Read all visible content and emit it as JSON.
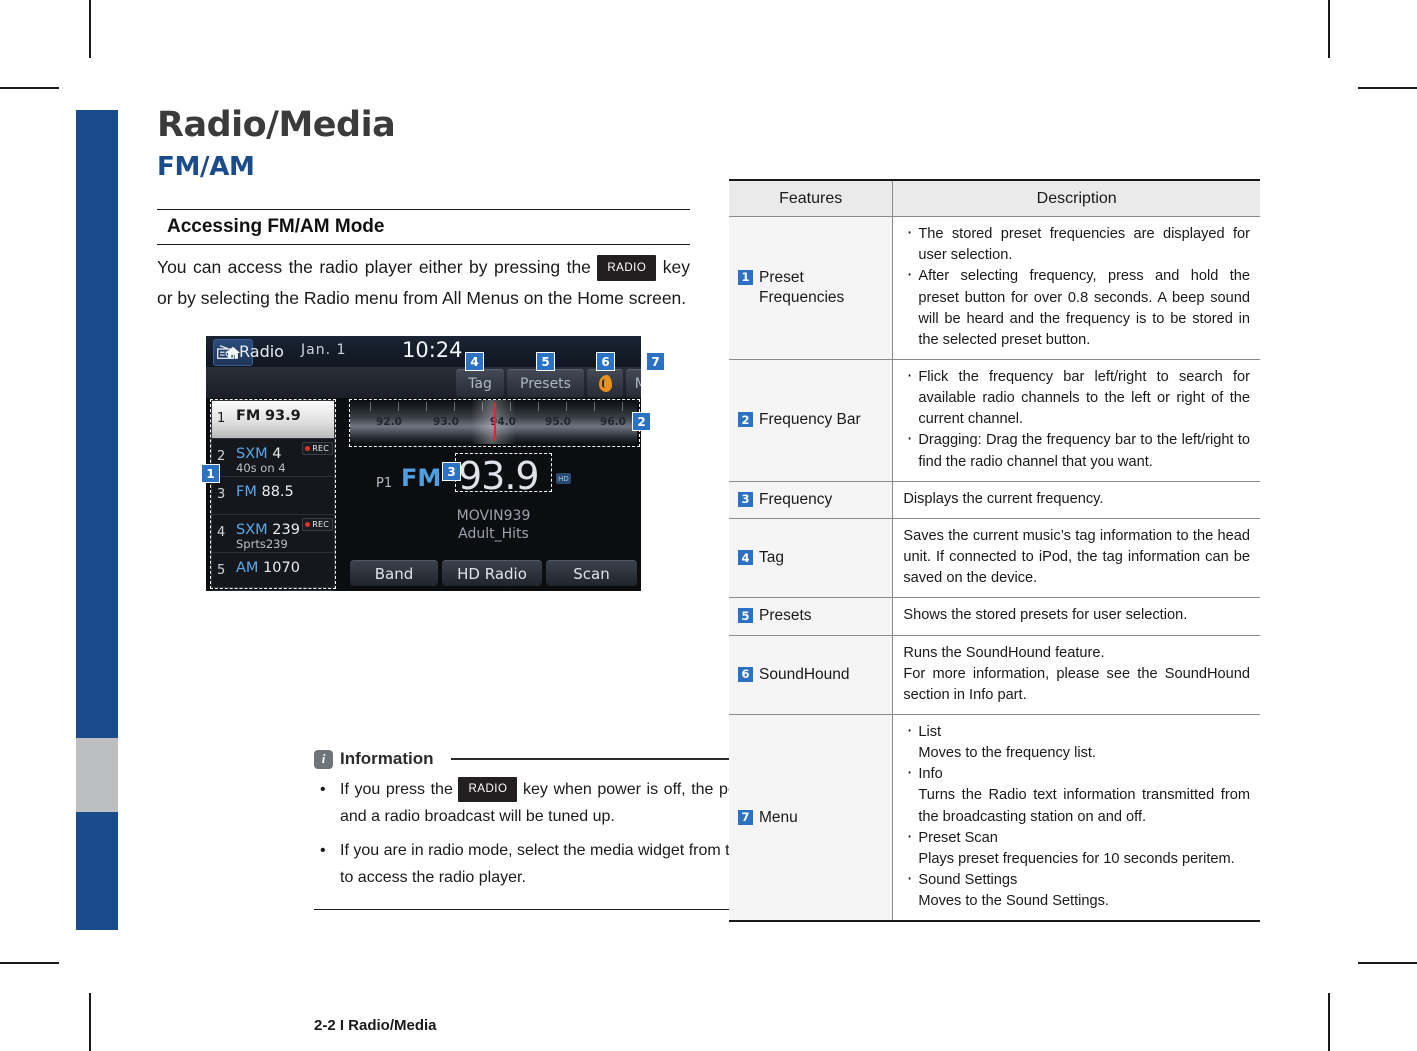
{
  "page": {
    "title": "Radio/Media",
    "section": "FM/AM",
    "subhead": "Accessing FM/AM Mode",
    "body_part1": "You can access the radio player either by pressing the",
    "body_keycap": "RADIO",
    "body_part2": "key or by selecting the Radio menu from All Menus on the Home screen.",
    "footer": "2-2 I Radio/Media"
  },
  "information": {
    "heading": "Information",
    "icon": "info-icon",
    "items": [
      {
        "before": "If you press the",
        "keycap": "RADIO",
        "after": "key when power is off, the power will turn on and a radio broadcast will be tuned up."
      },
      {
        "before": "",
        "keycap": "",
        "after": "If you are in radio mode, select the media widget from the Home screen to access the radio player."
      }
    ]
  },
  "radio_ui": {
    "status": {
      "home_icon": "home-icon",
      "date": "Jan.  1",
      "clock": "10:24"
    },
    "toolbar": {
      "mode_icon": "radio-icon",
      "mode_label": "Radio",
      "buttons": [
        {
          "label": "Tag",
          "name": "tag-button",
          "badge": "4"
        },
        {
          "label": "Presets",
          "name": "presets-button",
          "badge": "5"
        },
        {
          "label": "",
          "name": "soundhound-button",
          "badge": "6",
          "icon": "soundhound-icon"
        },
        {
          "label": "Menu",
          "name": "menu-button",
          "badge": "7"
        },
        {
          "label": "",
          "name": "back-button",
          "icon": "back-arrow-icon"
        }
      ]
    },
    "presets_badge": "1",
    "presets": [
      {
        "num": "1",
        "band": "FM",
        "freq": "93.9",
        "sub": "",
        "rec": false,
        "selected": true
      },
      {
        "num": "2",
        "band": "SXM",
        "freq": "4",
        "sub": "40s on 4",
        "rec": true,
        "selected": false
      },
      {
        "num": "3",
        "band": "FM",
        "freq": "88.5",
        "sub": "",
        "rec": false,
        "selected": false
      },
      {
        "num": "4",
        "band": "SXM",
        "freq": "239",
        "sub": "Sprts239",
        "rec": true,
        "selected": false
      },
      {
        "num": "5",
        "band": "AM",
        "freq": "1070",
        "sub": "",
        "rec": false,
        "selected": false
      }
    ],
    "rec_label": "REC",
    "frequency_bar": {
      "badge": "2",
      "ticks": [
        "92.0",
        "93.0",
        "94.0",
        "95.0",
        "96.0"
      ],
      "needle_value": "93.9"
    },
    "now_playing": {
      "badge": "3",
      "preset": "P1",
      "band": "FM",
      "frequency": "93.9",
      "hd_icon": "hd-radio-icon",
      "station": "MOVIN939",
      "genre": "Adult_Hits"
    },
    "bottom_buttons": [
      {
        "label": "Band",
        "name": "band-button"
      },
      {
        "label": "HD Radio",
        "name": "hd-radio-button"
      },
      {
        "label": "Scan",
        "name": "scan-button"
      }
    ]
  },
  "table": {
    "headers": [
      "Features",
      "Description"
    ],
    "rows": [
      {
        "badge": "1",
        "feature": "Preset\nFrequencies",
        "desc": [
          {
            "type": "bullet",
            "text": "The stored preset frequencies are displayed for user selection."
          },
          {
            "type": "bullet",
            "text": "After selecting frequency, press and hold the preset button for over 0.8 seconds. A beep sound will be heard and the frequency is to be stored in the selected preset button."
          }
        ]
      },
      {
        "badge": "2",
        "feature": "Frequency Bar",
        "desc": [
          {
            "type": "bullet",
            "text": "Flick the frequency bar left/right to search for available radio channels to the left or right of the current channel."
          },
          {
            "type": "bullet",
            "text": "Dragging: Drag the frequency bar to the left/right to find the radio channel that you want."
          }
        ]
      },
      {
        "badge": "3",
        "feature": "Frequency",
        "desc": [
          {
            "type": "plain",
            "text": "Displays the current frequency."
          }
        ]
      },
      {
        "badge": "4",
        "feature": "Tag",
        "desc": [
          {
            "type": "plain",
            "text": "Saves the current music’s tag information to the head unit. If connected to iPod, the tag information can be saved on the device."
          }
        ]
      },
      {
        "badge": "5",
        "feature": "Presets",
        "desc": [
          {
            "type": "plain",
            "text": "Shows the stored presets for user selection."
          }
        ]
      },
      {
        "badge": "6",
        "feature": "SoundHound",
        "desc": [
          {
            "type": "plain",
            "text": "Runs the SoundHound feature."
          },
          {
            "type": "plain",
            "text": "For more information, please see the SoundHound section in Info part."
          }
        ]
      },
      {
        "badge": "7",
        "feature": "Menu",
        "desc": [
          {
            "type": "bullet",
            "text": "List"
          },
          {
            "type": "sub",
            "text": "Moves to the frequency list."
          },
          {
            "type": "bullet",
            "text": "Info"
          },
          {
            "type": "sub",
            "text": "Turns the Radio text information transmitted from the broadcasting station on and off."
          },
          {
            "type": "bullet",
            "text": "Preset Scan"
          },
          {
            "type": "sub",
            "text": "Plays preset frequencies for 10 seconds peritem."
          },
          {
            "type": "bullet",
            "text": "Sound Settings"
          },
          {
            "type": "sub",
            "text": "Moves to the Sound Settings."
          }
        ]
      }
    ]
  },
  "colors": {
    "brand_blue": "#1a4b8c",
    "badge_blue": "#2c72c4",
    "gray_band": "#bcbec0"
  }
}
